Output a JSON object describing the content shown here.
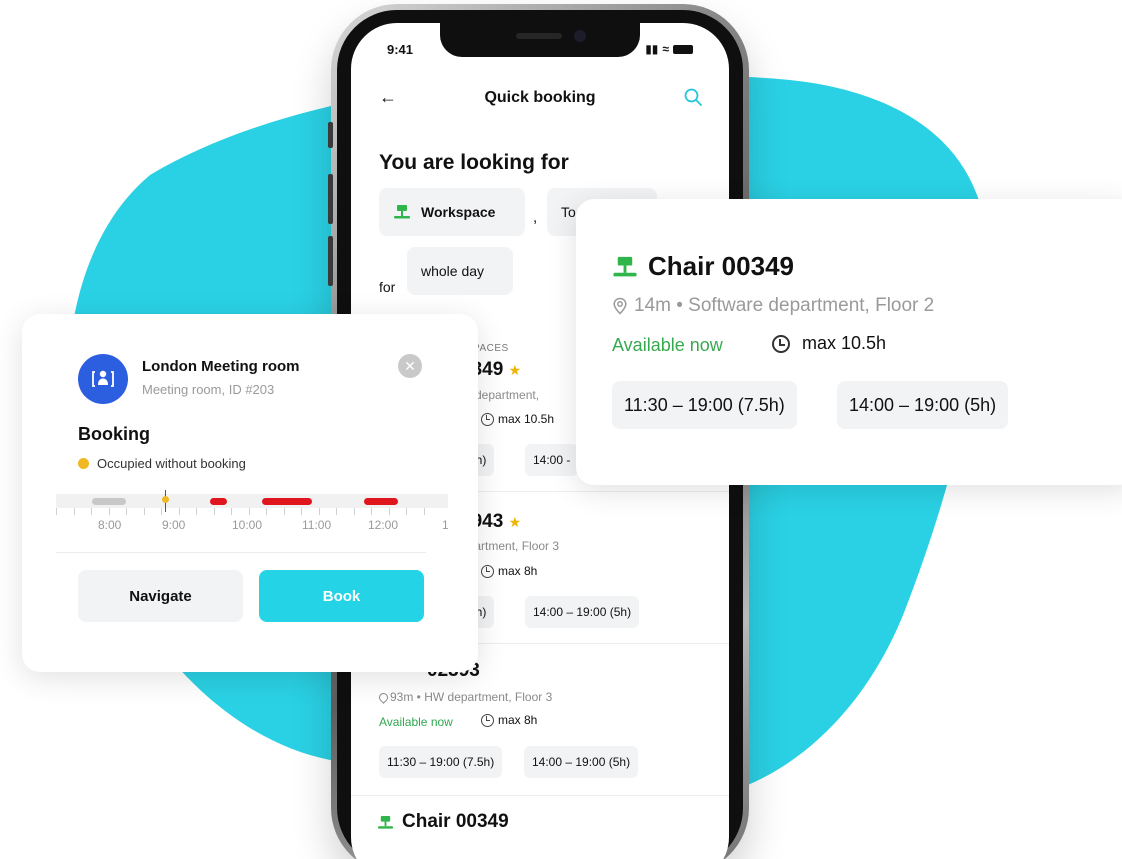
{
  "colors": {
    "brand_cyan": "#24d3e6",
    "blob": "#2ad1e4",
    "available_green": "#37a94e",
    "desk_green": "#2fb54a",
    "star": "#f0b400",
    "occupied_red": "#e0161f",
    "occupied_yellow": "#f2b823",
    "avatar_blue": "#2c5fe0"
  },
  "status_bar": {
    "time": "9:41"
  },
  "app": {
    "title": "Quick booking",
    "looking_for_title": "You are looking for",
    "chip_type": "Workspace",
    "chip_type_icon": "desk-icon",
    "comma": ",",
    "chip_time_partial": "To",
    "for_label": "for",
    "chip_duration": "whole day",
    "section_partial": "RKSPACES",
    "list": [
      {
        "title_partial": "0349",
        "starred": true,
        "sub_partial": "re department,",
        "max": "max 10.5h",
        "slots": [
          "7.5h)",
          "14:00 -"
        ]
      },
      {
        "title_partial": "2943",
        "starred": true,
        "sub_partial": "epartment, Floor 3",
        "max": "max 8h",
        "slots": [
          "7.5h)",
          "14:00 – 19:00 (5h)"
        ]
      },
      {
        "title_partial": "02393",
        "sub": "93m • HW department, Floor 3",
        "availability": "Available now",
        "max": "max 8h",
        "slots": [
          "11:30 – 19:00 (7.5h)",
          "14:00 – 19:00 (5h)"
        ]
      },
      {
        "title": "Chair 00349"
      }
    ]
  },
  "chair_card": {
    "title": "Chair 00349",
    "location": "14m • Software department, Floor 2",
    "availability": "Available now",
    "max": "max 10.5h",
    "slots": [
      "11:30 – 19:00 (7.5h)",
      "14:00 – 19:00 (5h)"
    ]
  },
  "room_card": {
    "name": "London Meeting room",
    "subtitle": "Meeting room, ID #203",
    "booking_title": "Booking",
    "status": "Occupied without booking",
    "timeline_labels": [
      "8:00",
      "9:00",
      "10:00",
      "11:00",
      "12:00",
      "1"
    ],
    "navigate_label": "Navigate",
    "book_label": "Book"
  }
}
